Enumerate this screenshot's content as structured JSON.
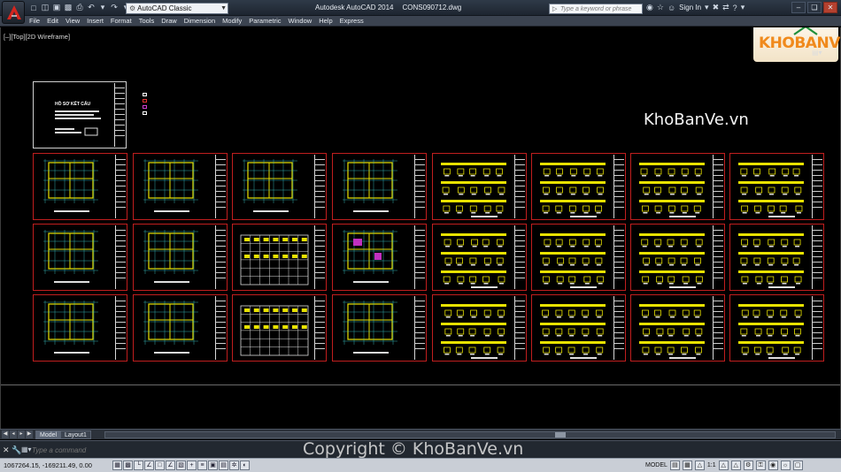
{
  "titlebar": {
    "app_name": "Autodesk AutoCAD 2014",
    "file_name": "CONS090712.dwg",
    "workspace": "AutoCAD Classic",
    "search_placeholder": "Type a keyword or phrase",
    "sign_in": "Sign In",
    "icons": [
      "new-icon",
      "open-icon",
      "save-icon",
      "saveas-icon",
      "print-icon",
      "undo-icon",
      "redo-icon",
      "workspace-gear-icon",
      "search-icon",
      "binoculars-icon",
      "star-icon",
      "user-icon",
      "cart-icon",
      "exchange-icon",
      "help-icon"
    ]
  },
  "menus": [
    "File",
    "Edit",
    "View",
    "Insert",
    "Format",
    "Tools",
    "Draw",
    "Dimension",
    "Modify",
    "Parametric",
    "Window",
    "Help",
    "Express"
  ],
  "viewport": {
    "label": "[–][Top][2D Wireframe]",
    "watermark": "KhoBanVe.vn",
    "logo_text": "KHOBANVE"
  },
  "cover_sheet": {
    "title": "HỒ SƠ KẾT CẤU"
  },
  "layout_tabs": [
    {
      "label": "Model",
      "active": true
    },
    {
      "label": "Layout1",
      "active": false
    }
  ],
  "command": {
    "placeholder": "Type a command",
    "copyright": "Copyright © KhoBanVe.vn"
  },
  "status": {
    "coordinates": "1067264.15, -169211.49, 0.00",
    "model_label": "MODEL",
    "scale": "1:1",
    "toggles": [
      "snap",
      "grid",
      "ortho",
      "polar",
      "osnap",
      "otrack",
      "ducs",
      "dyn",
      "lwt",
      "tpy",
      "qp",
      "sc",
      "am"
    ]
  },
  "colors": {
    "background": "#000000",
    "accent_red": "#c01e1e",
    "drawing_yellow": "#e8e200",
    "logo_orange": "#f08a1c"
  }
}
